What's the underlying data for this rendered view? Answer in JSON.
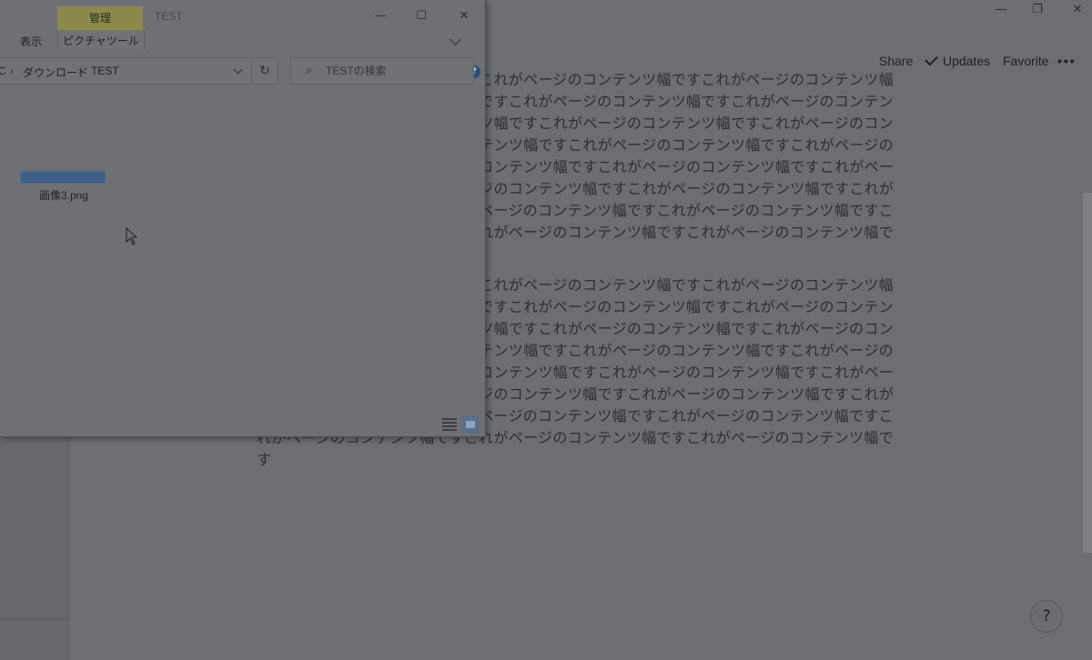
{
  "background_app": {
    "window_controls": {
      "minimize": "—",
      "restore": "❐",
      "close": "✕"
    },
    "toolbar": {
      "share": "Share",
      "updates": "Updates",
      "favorite": "Favorite",
      "more": "•••"
    },
    "paragraphs": [
      "これがページのコンテンツ幅ですこれがページのコンテンツ幅ですこれがページのコンテンツ幅ですこれがページのコンテンツ幅ですこれがページのコンテンツ幅ですこれがページのコンテンツ幅ですこれがページのコンテンツ幅ですこれがページのコンテンツ幅ですこれがページのコンテンツ幅ですこれがページのコンテンツ幅ですこれがページのコンテンツ幅ですこれがページのコンテンツ幅ですこれがページのコンテンツ幅ですこれがページのコンテンツ幅ですこれがページのコンテンツ幅ですこれがページのコンテンツ幅ですこれがページのコンテンツ幅ですこれがページのコンテンツ幅ですこれがページのコンテンツ幅ですこれがページのコンテンツ幅ですこれがページのコンテンツ幅ですこれがページのコンテンツ幅ですこれがページのコンテンツ幅です",
      "これがページのコンテンツ幅ですこれがページのコンテンツ幅ですこれがページのコンテンツ幅ですこれがページのコンテンツ幅ですこれがページのコンテンツ幅ですこれがページのコンテンツ幅ですこれがページのコンテンツ幅ですこれがページのコンテンツ幅ですこれがページのコンテンツ幅ですこれがページのコンテンツ幅ですこれがページのコンテンツ幅ですこれがページのコンテンツ幅ですこれがページのコンテンツ幅ですこれがページのコンテンツ幅ですこれがページのコンテンツ幅ですこれがページのコンテンツ幅ですこれがページのコンテンツ幅ですこれがページのコンテンツ幅ですこれがページのコンテンツ幅ですこれがページのコンテンツ幅ですこれがページのコンテンツ幅ですこれがページのコンテンツ幅ですこれがページのコンテンツ幅です"
    ],
    "help_button": "?"
  },
  "explorer": {
    "title": "TEST",
    "contextual_tab": "管理",
    "ribbon": {
      "view_tab": "表示",
      "picture_tools_tab": "ピクチャツール",
      "help": "?"
    },
    "window_controls": {
      "minimize": "—",
      "maximize": "☐",
      "close": "✕"
    },
    "breadcrumb": {
      "root": "C",
      "downloads": "ダウンロード",
      "current": "TEST",
      "separator": "›"
    },
    "refresh": "↻",
    "search": {
      "placeholder": "TESTの検索",
      "icon": "⌕"
    },
    "files": [
      {
        "name": "画像3.png",
        "icon": "image-thumbnail-icon"
      }
    ],
    "colors": {
      "accent": "#3e5f86",
      "manage_tab": "#8c8a4a"
    }
  }
}
